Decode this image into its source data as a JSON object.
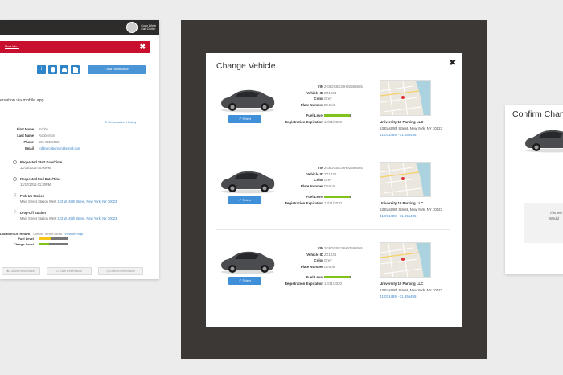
{
  "left_panel": {
    "user_name": "Cody White",
    "user_role": "Call Center",
    "alert_link": "More info...",
    "alert_close": "✖",
    "icons": [
      "info-icon",
      "location-icon",
      "car-icon",
      "document-icon"
    ],
    "add_button": "Add Reservation",
    "subtitle": "ervation via mobile app",
    "history_link": "Reservation History",
    "fields": {
      "labels": [
        "First Name",
        "Last Name",
        "Phone",
        "Email"
      ],
      "values": [
        "Robby",
        "Robberson",
        "555-555-5555",
        "robby.robberson@email.com"
      ]
    },
    "sections": [
      {
        "title": "Requested Start Date/Time",
        "detail": "12/16/2016 04:00PM"
      },
      {
        "title": "Requested End Date/Time",
        "detail": "12/17/2016 01:30PM"
      },
      {
        "title": "Pick-Up Station",
        "detail": "Main Street Station West",
        "link": "123 W. 48th Street, New York, NY 10023"
      },
      {
        "title": "Drop-Off Station",
        "detail": "Main Street Station West",
        "link": "123 W. 48th Street, New York, NY 10023"
      }
    ],
    "location_on_return": {
      "label": "Location On Return",
      "value": "Outside Return Area",
      "link": "View on map"
    },
    "fuel_label": "Fuel Level",
    "charge_label": "Charge Level",
    "fuel_level": 0.45,
    "charge_level": 0.35,
    "bottom_buttons": [
      "Cancel Reservation",
      "Start Reservation",
      "Extend Reservation"
    ]
  },
  "modal": {
    "title": "Change Vehicle",
    "close": "✖",
    "spec_labels": [
      "VIN",
      "Vehicle ID",
      "Color",
      "Plate Number"
    ],
    "fuel_label": "Fuel Level",
    "expiration_label": "Registration Expiration",
    "select_label": "Select",
    "vehicles": [
      {
        "vin": "2G6DG5E39H92595565",
        "vehicle_id": "ZZ1234",
        "color": "Grey",
        "plate": "Detroit",
        "fuel": 0.95,
        "expiration": "12/31/2020",
        "parking": "University 10 Parking LLC",
        "address": "63 East 9th Street, New York, NY 10023",
        "coords": "41.071489, -71.956495"
      },
      {
        "vin": "2G6DG5E39H92595565",
        "vehicle_id": "ZZ1234",
        "color": "Grey",
        "plate": "Detroit",
        "fuel": 0.95,
        "expiration": "12/31/2020",
        "parking": "University 10 Parking LLC",
        "address": "63 East 9th Street, New York, NY 10023",
        "coords": "41.071489, -71.956495"
      },
      {
        "vin": "2G6DG5E39H92595565",
        "vehicle_id": "ZZ1234",
        "color": "Grey",
        "plate": "Detroit",
        "fuel": 0.95,
        "expiration": "12/31/2020",
        "parking": "University 10 Parking LLC",
        "address": "63 East 9th Street, New York, NY 10023",
        "coords": "41.071489, -71.956495"
      }
    ]
  },
  "right_panel": {
    "title": "Confirm Change",
    "message_line1": "This veh",
    "message_line2": "Would"
  },
  "colors": {
    "brand_red": "#c8102e",
    "primary_blue": "#3f8fd9",
    "fuel_green": "#7fc31c",
    "fuel_yellow": "#f5c518",
    "overlay": "#3c3835"
  }
}
